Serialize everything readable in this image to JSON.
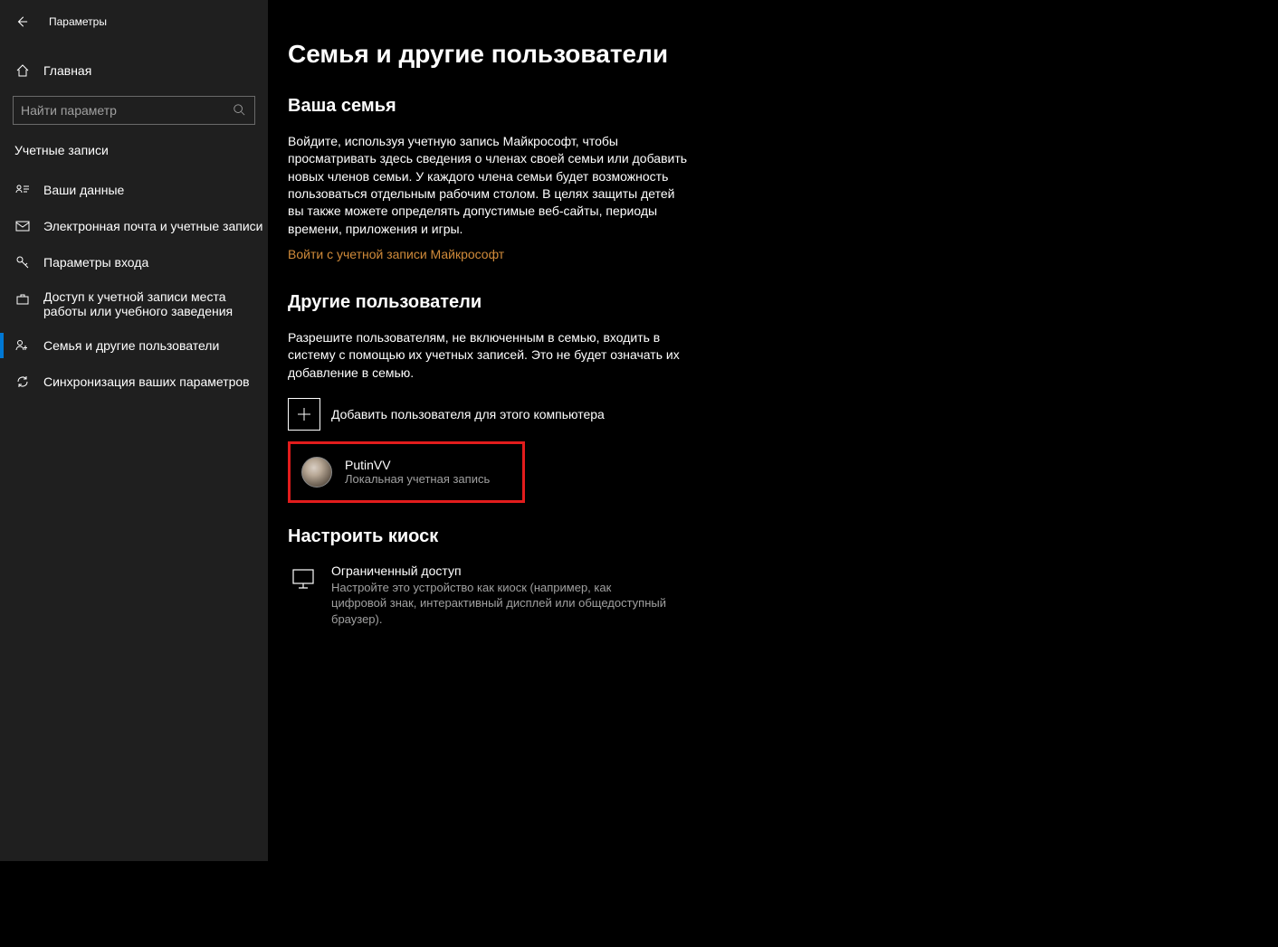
{
  "window": {
    "title": "Параметры"
  },
  "sidebar": {
    "home": "Главная",
    "search_placeholder": "Найти параметр",
    "category": "Учетные записи",
    "items": [
      {
        "label": "Ваши данные"
      },
      {
        "label": "Электронная почта и учетные записи"
      },
      {
        "label": "Параметры входа"
      },
      {
        "label": "Доступ к учетной записи места работы или учебного заведения"
      },
      {
        "label": "Семья и другие пользователи"
      },
      {
        "label": "Синхронизация ваших параметров"
      }
    ]
  },
  "main": {
    "title": "Семья и другие пользователи",
    "family": {
      "heading": "Ваша семья",
      "body": "Войдите, используя учетную запись Майкрософт, чтобы просматривать здесь сведения о членах своей семьи или добавить новых членов семьи. У каждого члена семьи будет возможность пользоваться отдельным рабочим столом. В целях защиты детей вы также можете определять допустимые веб-сайты, периоды времени, приложения и игры.",
      "signin_link": "Войти с учетной записи Майкрософт"
    },
    "other": {
      "heading": "Другие пользователи",
      "body": "Разрешите пользователям, не включенным в семью, входить в систему с помощью их учетных записей. Это не будет означать их добавление в семью.",
      "add_label": "Добавить пользователя для этого компьютера",
      "user": {
        "name": "PutinVV",
        "type": "Локальная учетная запись"
      }
    },
    "kiosk": {
      "heading": "Настроить киоск",
      "title": "Ограниченный доступ",
      "desc": "Настройте это устройство как киоск (например, как цифровой знак, интерактивный дисплей или общедоступный браузер)."
    }
  }
}
